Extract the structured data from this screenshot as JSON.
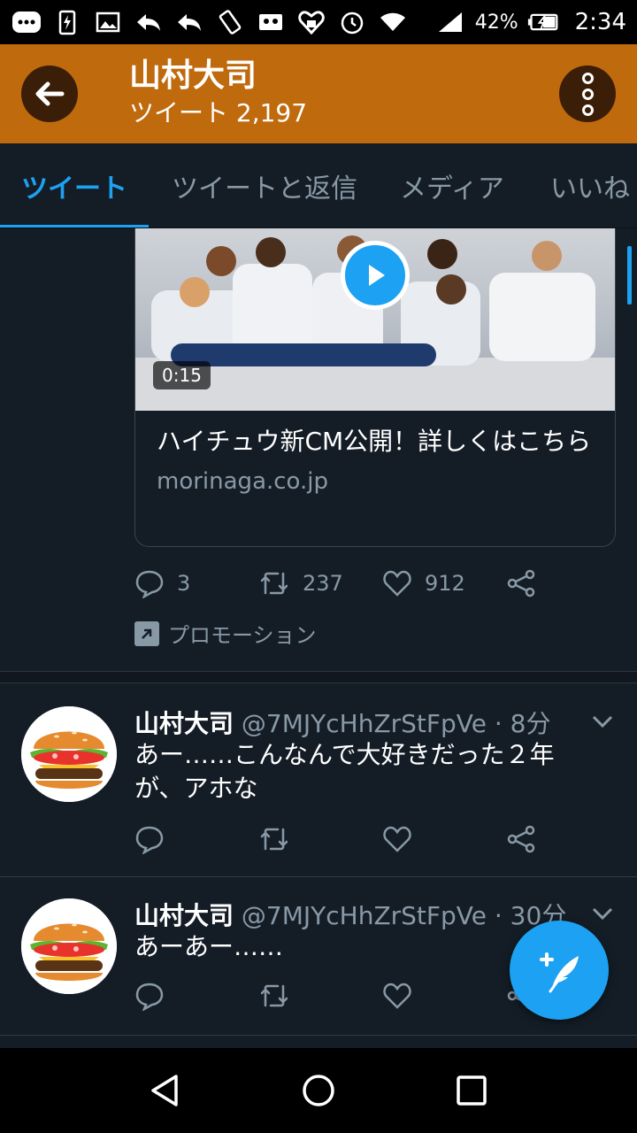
{
  "status_bar": {
    "battery": "42%",
    "time": "2:34"
  },
  "header": {
    "title": "山村大司",
    "subtitle": "ツイート 2,197"
  },
  "tabs": [
    {
      "label": "ツイート",
      "active": true
    },
    {
      "label": "ツイートと返信",
      "active": false
    },
    {
      "label": "メディア",
      "active": false
    },
    {
      "label": "いいね",
      "active": false
    }
  ],
  "promoted": {
    "duration": "0:15",
    "card_title": "ハイチュウ新CM公開！詳しくはこちら",
    "card_domain": "morinaga.co.jp",
    "replies": "3",
    "retweets": "237",
    "likes": "912",
    "promo_label": "プロモーション"
  },
  "tweets": [
    {
      "name": "山村大司",
      "handle": "@7MJYcHhZrStFpVe · 8分",
      "text": "あー……こんなんで大好きだった２年が、アホな"
    },
    {
      "name": "山村大司",
      "handle": "@7MJYcHhZrStFpVe · 30分",
      "text": "あーあー……"
    }
  ],
  "colors": {
    "accent": "#1da1f2",
    "header": "#c06a0e",
    "background": "#141d26"
  }
}
